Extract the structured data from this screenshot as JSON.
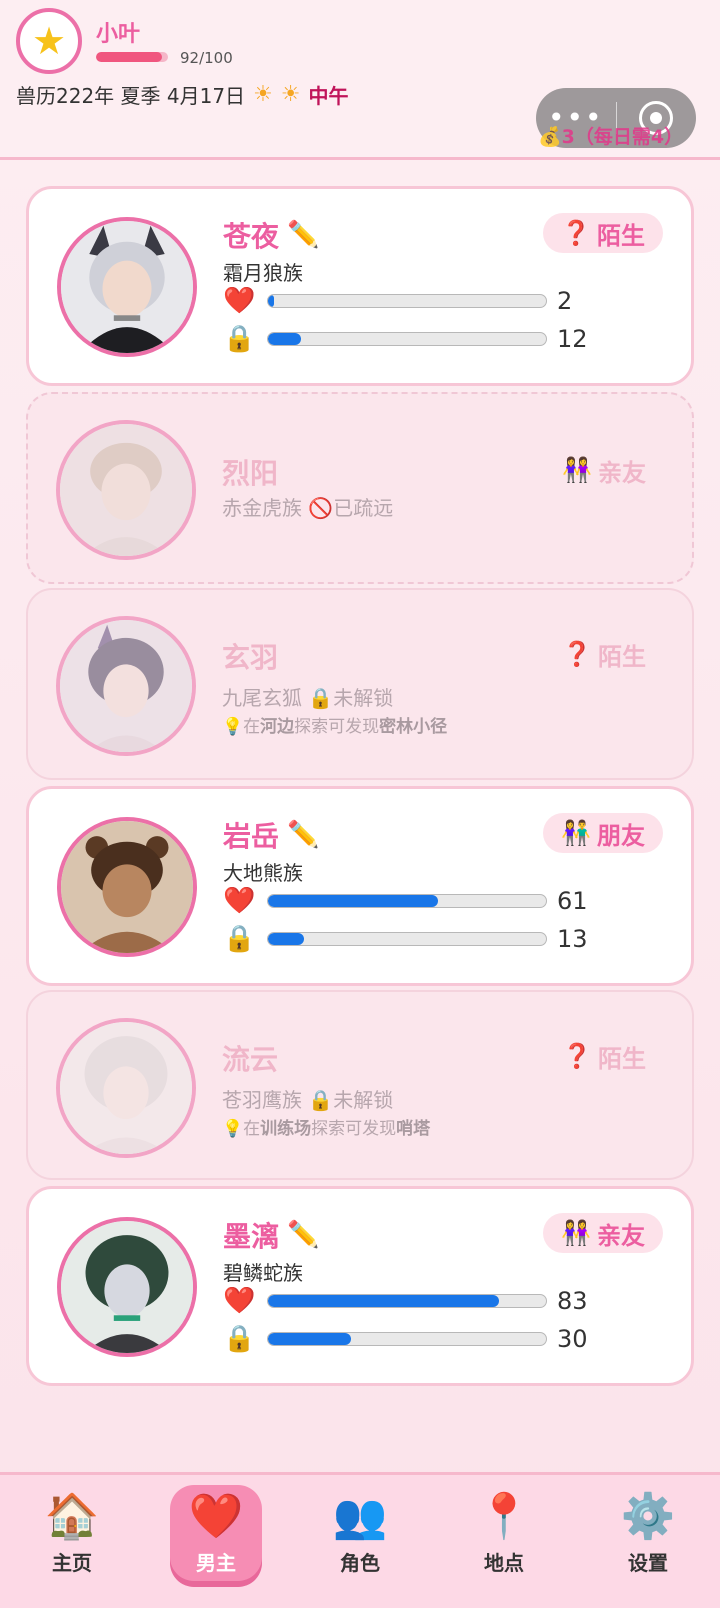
{
  "header": {
    "user_avatar_icon": "star",
    "user_name": "小叶",
    "xp_text": "92/100",
    "xp_fraction": 0.92,
    "date_text": "兽历222年 夏季 4月17日",
    "weather_icons": [
      "sun",
      "sun"
    ],
    "time_label": "中午",
    "coins_text": "💰3（每日需4）"
  },
  "characters": [
    {
      "name": "苍夜",
      "race": "霜月狼族",
      "status": "陌生",
      "status_icon": "question",
      "editable": true,
      "affection": 2,
      "lock": 12,
      "state": "active"
    },
    {
      "name": "烈阳",
      "race": "赤金虎族",
      "note": "已疏远",
      "note_icon": "prohibited",
      "status": "亲友",
      "status_icon": "two-women",
      "state": "estranged"
    },
    {
      "name": "玄羽",
      "race": "九尾玄狐",
      "note": "未解锁",
      "note_icon": "lock",
      "hint_prefix": "在",
      "hint_place": "河边",
      "hint_middle": "探索可发现",
      "hint_target": "密林小径",
      "status": "陌生",
      "status_icon": "question",
      "state": "locked"
    },
    {
      "name": "岩岳",
      "race": "大地熊族",
      "status": "朋友",
      "status_icon": "friends",
      "editable": true,
      "affection": 61,
      "lock": 13,
      "state": "active"
    },
    {
      "name": "流云",
      "race": "苍羽鹰族",
      "note": "未解锁",
      "note_icon": "lock",
      "hint_prefix": "在",
      "hint_place": "训练场",
      "hint_middle": "探索可发现",
      "hint_target": "哨塔",
      "status": "陌生",
      "status_icon": "question",
      "state": "locked"
    },
    {
      "name": "墨漓",
      "race": "碧鳞蛇族",
      "status": "亲友",
      "status_icon": "two-women",
      "editable": true,
      "affection": 83,
      "lock": 30,
      "state": "active"
    }
  ],
  "stat_max": 100,
  "nav": [
    {
      "icon": "🏠",
      "label": "主页",
      "active": false
    },
    {
      "icon": "❤️",
      "label": "男主",
      "active": true
    },
    {
      "icon": "👥",
      "label": "角色",
      "active": false
    },
    {
      "icon": "📍",
      "label": "地点",
      "active": false
    },
    {
      "icon": "⚙️",
      "label": "设置",
      "active": false
    }
  ],
  "colors": {
    "accent_pink": "#ec5ea0",
    "bar_blue": "#1976e8",
    "xp_red": "#f0567f",
    "time_red": "#c0145a"
  }
}
